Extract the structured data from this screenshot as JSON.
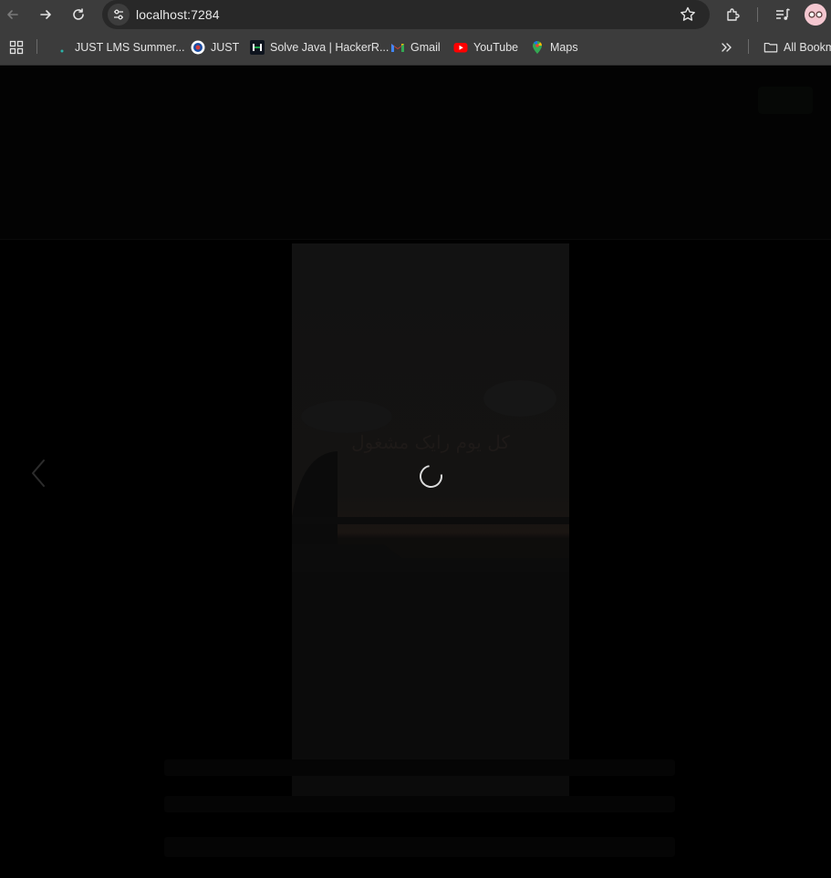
{
  "browser": {
    "url": "localhost:7284",
    "bookmarks": [
      {
        "label": "JUST LMS Summer...",
        "icon": "dot-icon"
      },
      {
        "label": "JUST",
        "icon": "just-logo-icon"
      },
      {
        "label": "Solve Java | HackerR...",
        "icon": "hackerrank-icon"
      },
      {
        "label": "Gmail",
        "icon": "gmail-icon"
      },
      {
        "label": "YouTube",
        "icon": "youtube-icon"
      },
      {
        "label": "Maps",
        "icon": "maps-icon"
      }
    ],
    "all_bookmarks_label": "All Bookmarks"
  },
  "page": {
    "story": {
      "caption": "کل یوم رایک مشغول"
    }
  },
  "colors": {
    "chrome": "#3c3c3c",
    "omnibox": "#282828",
    "overlay": "#000000"
  }
}
